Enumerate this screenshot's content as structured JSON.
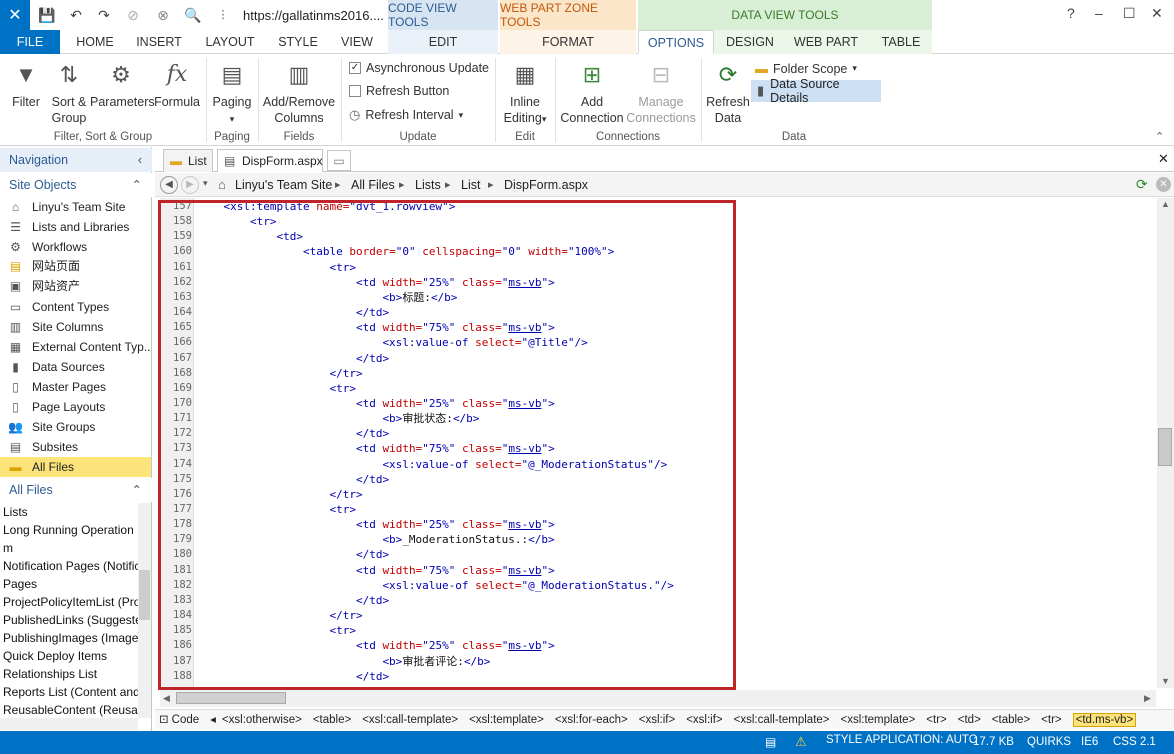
{
  "titlebar": {
    "url": "https://gallatinms2016....",
    "ctx_code": "CODE VIEW TOOLS",
    "ctx_wpz": "WEB PART ZONE TOOLS",
    "ctx_data": "DATA VIEW TOOLS",
    "help": "?",
    "minimize": "‒",
    "maximize": "☐",
    "close": "✕"
  },
  "tabs": {
    "file": "FILE",
    "home": "HOME",
    "insert": "INSERT",
    "layout": "LAYOUT",
    "style": "STYLE",
    "view": "VIEW",
    "edit": "EDIT",
    "format": "FORMAT",
    "options": "OPTIONS",
    "design": "DESIGN",
    "webpart": "WEB PART",
    "table": "TABLE"
  },
  "ribbon": {
    "filter": "Filter",
    "sort1": "Sort &",
    "sort2": "Group",
    "parameters": "Parameters",
    "formula": "Formula",
    "group_fsg": "Filter, Sort & Group",
    "paging": "Paging",
    "group_paging": "Paging",
    "addremove1": "Add/Remove",
    "addremove2": "Columns",
    "group_fields": "Fields",
    "async": "Asynchronous Update",
    "refresh_button": "Refresh Button",
    "refresh_interval": "Refresh Interval",
    "group_update": "Update",
    "inline1": "Inline",
    "inline2": "Editing",
    "group_edit": "Edit",
    "addconn1": "Add",
    "addconn2": "Connection",
    "manage1": "Manage",
    "manage2": "Connections",
    "group_connections": "Connections",
    "refresh1": "Refresh",
    "refresh2": "Data",
    "folder_scope": "Folder Scope",
    "dsd": "Data Source Details",
    "group_data": "Data"
  },
  "nav": {
    "header": "Navigation",
    "site_objects": "Site Objects",
    "items": [
      "Linyu's Team Site",
      "Lists and Libraries",
      "Workflows",
      "网站页面",
      "网站资产",
      "Content Types",
      "Site Columns",
      "External Content Typ...",
      "Data Sources",
      "Master Pages",
      "Page Layouts",
      "Site Groups",
      "Subsites",
      "All Files"
    ],
    "all_files_header": "All Files",
    "files": [
      "Lists",
      "Long Running Operation",
      "m",
      "Notification Pages (Notific",
      "Pages",
      "ProjectPolicyItemList (Proj",
      "PublishedLinks (Suggeste",
      "PublishingImages (Images",
      "Quick Deploy Items",
      "Relationships List",
      "Reports List (Content and",
      "ReusableContent (Reusab"
    ]
  },
  "doctabs": {
    "list": "List",
    "dispform": "DispForm.aspx"
  },
  "breadcrumb": [
    "Linyu's Team Site",
    "All Files",
    "Lists",
    "List",
    "DispForm.aspx"
  ],
  "code": {
    "line_numbers": [
      "157",
      "158",
      "159",
      "160",
      "161",
      "162",
      "163",
      "164",
      "165",
      "166",
      "167",
      "168",
      "169",
      "170",
      "171",
      "172",
      "173",
      "174",
      "175",
      "176",
      "177",
      "178",
      "179",
      "180",
      "181",
      "182",
      "183",
      "184",
      "185",
      "186",
      "187",
      "188"
    ]
  },
  "tagbar": {
    "code": "Code",
    "tags": [
      "<xsl:otherwise>",
      "<table>",
      "<xsl:call-template>",
      "<xsl:template>",
      "<xsl:for-each>",
      "<xsl:if>",
      "<xsl:if>",
      "<xsl:call-template>",
      "<xsl:template>",
      "<tr>",
      "<td>",
      "<table>",
      "<tr>"
    ],
    "selected": "<td.ms-vb>"
  },
  "status": {
    "style_app": "STYLE APPLICATION: AUTO",
    "size": "17.7 KB",
    "mode": "QUIRKS",
    "browser": "IE6",
    "css": "CSS 2.1"
  }
}
